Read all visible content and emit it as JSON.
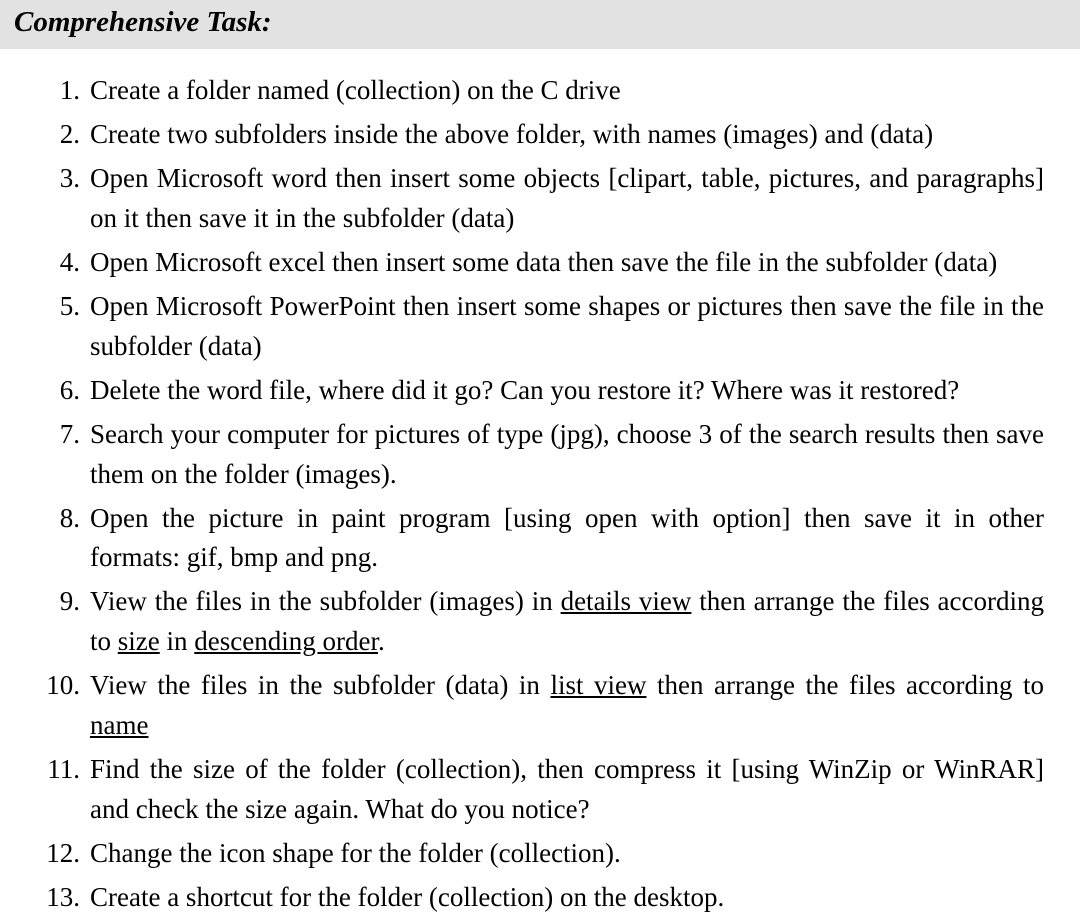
{
  "heading": "Comprehensive Task:",
  "items": [
    "Create a folder named (collection) on the C drive",
    "Create two subfolders inside the above folder, with names (images) and (data)",
    "Open Microsoft word then insert some objects [clipart, table, pictures, and paragraphs] on it then save it in the subfolder (data)",
    "Open Microsoft excel then insert some data then save the file in the subfolder (data)",
    "Open Microsoft PowerPoint then insert some shapes or pictures then save the file in the subfolder (data)",
    "Delete the word file, where did it go? Can you restore it? Where was it restored?",
    "Search your computer for pictures of type (jpg), choose 3 of the search results then save them on the folder (images).",
    "Open the picture in paint program [using open with option] then save it in other formats: gif, bmp and png.",
    {
      "segments": [
        {
          "text": "View the files in the subfolder (images) in "
        },
        {
          "text": "details view",
          "underline": true
        },
        {
          "text": " then arrange the files according to "
        },
        {
          "text": "size",
          "underline": true
        },
        {
          "text": " in "
        },
        {
          "text": "descending order",
          "underline": true
        },
        {
          "text": "."
        }
      ]
    },
    {
      "segments": [
        {
          "text": "View the files in the subfolder (data) in "
        },
        {
          "text": "list view",
          "underline": true
        },
        {
          "text": " then arrange the files according to "
        },
        {
          "text": "name",
          "underline": true
        }
      ]
    },
    "Find the size of the folder (collection), then compress it [using WinZip or WinRAR] and check the size again. What do you notice?",
    "Change the icon shape for the folder (collection).",
    "Create a shortcut for the folder (collection) on the desktop."
  ]
}
